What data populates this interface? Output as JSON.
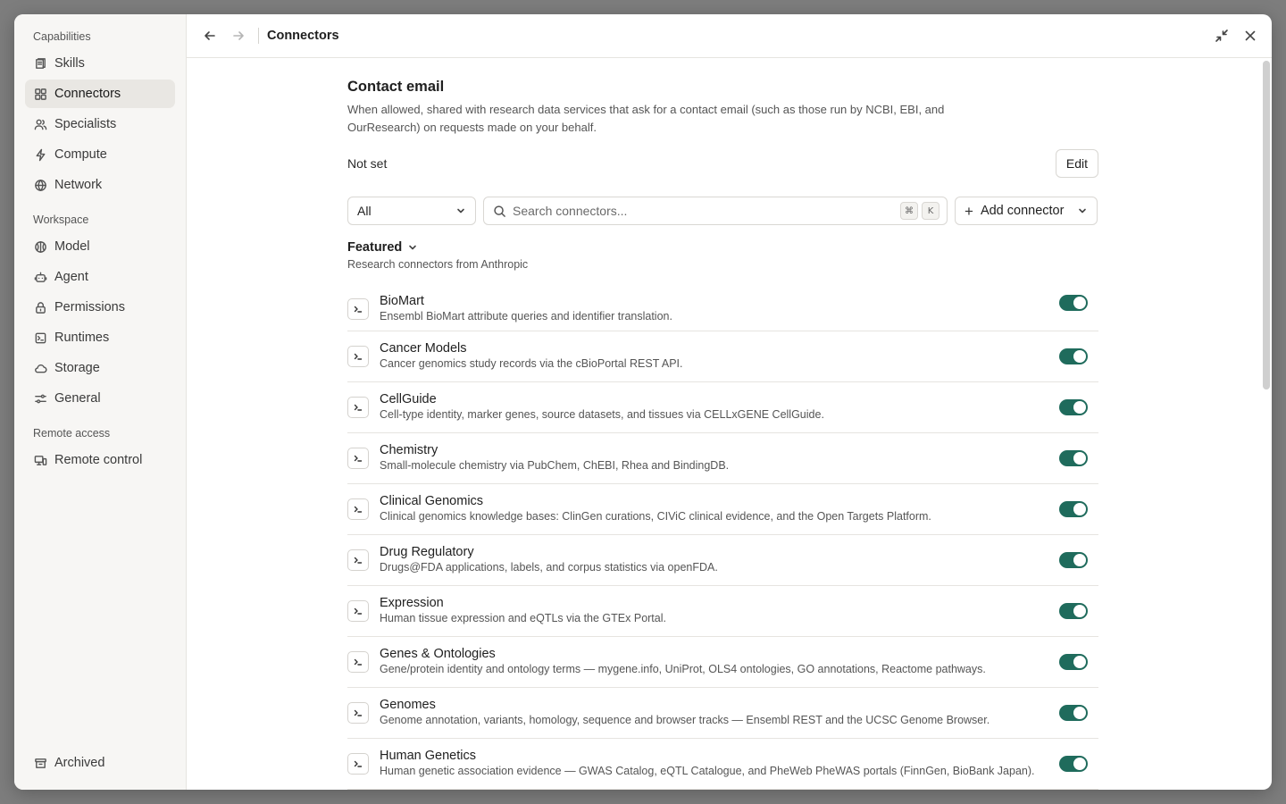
{
  "sidebar": {
    "sections": [
      {
        "label": "Capabilities",
        "items": [
          {
            "label": "Skills",
            "icon": "skills-icon"
          },
          {
            "label": "Connectors",
            "icon": "connectors-icon"
          },
          {
            "label": "Specialists",
            "icon": "specialists-icon"
          },
          {
            "label": "Compute",
            "icon": "compute-icon"
          },
          {
            "label": "Network",
            "icon": "network-icon"
          }
        ]
      },
      {
        "label": "Workspace",
        "items": [
          {
            "label": "Model",
            "icon": "model-icon"
          },
          {
            "label": "Agent",
            "icon": "agent-icon"
          },
          {
            "label": "Permissions",
            "icon": "permissions-icon"
          },
          {
            "label": "Runtimes",
            "icon": "runtimes-icon"
          },
          {
            "label": "Storage",
            "icon": "storage-icon"
          },
          {
            "label": "General",
            "icon": "general-icon"
          }
        ]
      },
      {
        "label": "Remote access",
        "items": [
          {
            "label": "Remote control",
            "icon": "remote-control-icon"
          }
        ]
      }
    ],
    "active_item": "Connectors",
    "bottom": {
      "label": "Archived",
      "icon": "archive-icon"
    }
  },
  "header": {
    "title": "Connectors"
  },
  "contact_email": {
    "title": "Contact email",
    "description": "When allowed, shared with research data services that ask for a contact email (such as those run by NCBI, EBI, and OurResearch) on requests made on your behalf.",
    "value": "Not set",
    "edit_label": "Edit"
  },
  "filters": {
    "category_selected": "All",
    "search_placeholder": "Search connectors...",
    "shortcut_keys": [
      "⌘",
      "K"
    ],
    "add_label": "Add connector"
  },
  "featured": {
    "title": "Featured",
    "subtitle": "Research connectors from Anthropic"
  },
  "connectors": [
    {
      "name": "BioMart",
      "description": "Ensembl BioMart attribute queries and identifier translation.",
      "enabled": true
    },
    {
      "name": "Cancer Models",
      "description": "Cancer genomics study records via the cBioPortal REST API.",
      "enabled": true
    },
    {
      "name": "CellGuide",
      "description": "Cell-type identity, marker genes, source datasets, and tissues via CELLxGENE CellGuide.",
      "enabled": true
    },
    {
      "name": "Chemistry",
      "description": "Small-molecule chemistry via PubChem, ChEBI, Rhea and BindingDB.",
      "enabled": true
    },
    {
      "name": "Clinical Genomics",
      "description": "Clinical genomics knowledge bases: ClinGen curations, CIViC clinical evidence, and the Open Targets Platform.",
      "enabled": true
    },
    {
      "name": "Drug Regulatory",
      "description": "Drugs@FDA applications, labels, and corpus statistics via openFDA.",
      "enabled": true
    },
    {
      "name": "Expression",
      "description": "Human tissue expression and eQTLs via the GTEx Portal.",
      "enabled": true
    },
    {
      "name": "Genes & Ontologies",
      "description": "Gene/protein identity and ontology terms — mygene.info, UniProt, OLS4 ontologies, GO annotations, Reactome pathways.",
      "enabled": true
    },
    {
      "name": "Genomes",
      "description": "Genome annotation, variants, homology, sequence and browser tracks — Ensembl REST and the UCSC Genome Browser.",
      "enabled": true
    },
    {
      "name": "Human Genetics",
      "description": "Human genetic association evidence — GWAS Catalog, eQTL Catalogue, and PheWeb PheWAS portals (FinnGen, BioBank Japan).",
      "enabled": true
    }
  ],
  "colors": {
    "toggle_on": "#1f6b5c",
    "active_nav_bg": "#e9e7e3",
    "sidebar_bg": "#f7f6f4"
  }
}
